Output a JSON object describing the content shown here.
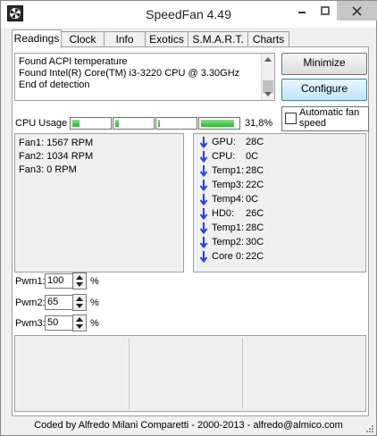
{
  "window": {
    "title": "SpeedFan 4.49"
  },
  "tabs": [
    "Readings",
    "Clock",
    "Info",
    "Exotics",
    "S.M.A.R.T.",
    "Charts"
  ],
  "log": {
    "lines": [
      "Found ACPI temperature",
      "Found Intel(R) Core(TM) i3-3220 CPU @ 3.30GHz",
      "End of detection"
    ]
  },
  "buttons": {
    "minimize": "Minimize",
    "configure": "Configure"
  },
  "auto_fan": {
    "label": "Automatic fan speed",
    "checked": false
  },
  "cpu_usage": {
    "label": "CPU Usage",
    "percent_text": "31,8%",
    "core_levels": [
      0.2,
      0.1,
      0.05,
      0.9
    ]
  },
  "fans": [
    "Fan1: 1567 RPM",
    "Fan2: 1034 RPM",
    "Fan3: 0 RPM"
  ],
  "temps": [
    {
      "name": "GPU:",
      "value": "28C"
    },
    {
      "name": "CPU:",
      "value": "0C"
    },
    {
      "name": "Temp1:",
      "value": "28C"
    },
    {
      "name": "Temp3:",
      "value": "22C"
    },
    {
      "name": "Temp4:",
      "value": "0C"
    },
    {
      "name": "HD0:",
      "value": "26C"
    },
    {
      "name": "Temp1:",
      "value": "28C"
    },
    {
      "name": "Temp2:",
      "value": "30C"
    },
    {
      "name": "Core 0:",
      "value": "22C"
    }
  ],
  "pwm": [
    {
      "label": "Pwm1:",
      "value": "100",
      "unit": "%"
    },
    {
      "label": "Pwm2:",
      "value": "65",
      "unit": "%"
    },
    {
      "label": "Pwm3:",
      "value": "50",
      "unit": "%"
    }
  ],
  "status": "Coded by Alfredo Milani Comparetti - 2000-2013 - alfredo@almico.com",
  "colors": {
    "accent_blue": "#1f3fff",
    "bar_green": "#2fb52f"
  }
}
